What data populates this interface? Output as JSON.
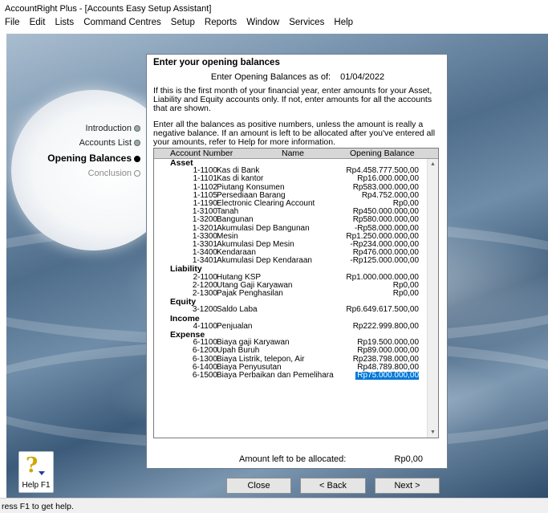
{
  "window": {
    "title": "AccountRight Plus - [Accounts Easy Setup Assistant]"
  },
  "menu": [
    "File",
    "Edit",
    "Lists",
    "Command Centres",
    "Setup",
    "Reports",
    "Window",
    "Services",
    "Help"
  ],
  "nav": {
    "steps": [
      {
        "label": "Introduction",
        "state": "done"
      },
      {
        "label": "Accounts List",
        "state": "done"
      },
      {
        "label": "Opening Balances",
        "state": "active"
      },
      {
        "label": "Conclusion",
        "state": "pending"
      }
    ]
  },
  "dialog": {
    "heading": "Enter your opening balances",
    "date_label": "Enter Opening Balances as of:",
    "date_value": "01/04/2022",
    "para1": "If this is the first month of your financial year, enter amounts for your Asset, Liability and Equity accounts only.  If not, enter amounts for all the accounts that are shown.",
    "para2": "Enter all the balances as positive numbers, unless the amount is really a negative balance.  If an amount is left to be allocated after you've entered all your amounts, refer to Help for more information.",
    "columns": {
      "number": "Account Number",
      "name": "Name",
      "balance": "Opening Balance"
    },
    "groups": [
      {
        "label": "Asset",
        "rows": [
          {
            "number": "1-1100",
            "name": "Kas di Bank",
            "balance": "Rp4.458.777.500,00"
          },
          {
            "number": "1-1101",
            "name": "Kas di kantor",
            "balance": "Rp16.000.000,00"
          },
          {
            "number": "1-1102",
            "name": "Piutang Konsumen",
            "balance": "Rp583.000.000,00"
          },
          {
            "number": "1-1105",
            "name": "Persediaan Barang",
            "balance": "Rp4.752.000,00"
          },
          {
            "number": "1-1190",
            "name": "Electronic Clearing Account",
            "balance": "Rp0,00"
          },
          {
            "number": "1-3100",
            "name": "Tanah",
            "balance": "Rp450.000.000,00"
          },
          {
            "number": "1-3200",
            "name": "Bangunan",
            "balance": "Rp580.000.000,00"
          },
          {
            "number": "1-3201",
            "name": "Akumulasi Dep Bangunan",
            "balance": "-Rp58.000.000,00"
          },
          {
            "number": "1-3300",
            "name": "Mesin",
            "balance": "Rp1.250.000.000,00"
          },
          {
            "number": "1-3301",
            "name": "Akumulasi Dep Mesin",
            "balance": "-Rp234.000.000,00"
          },
          {
            "number": "1-3400",
            "name": "Kendaraan",
            "balance": "Rp476.000.000,00"
          },
          {
            "number": "1-3401",
            "name": "Akumulasi Dep Kendaraan",
            "balance": "-Rp125.000.000,00"
          }
        ]
      },
      {
        "label": "Liability",
        "rows": [
          {
            "number": "2-1100",
            "name": "Hutang KSP",
            "balance": "Rp1.000.000.000,00"
          },
          {
            "number": "2-1200",
            "name": "Utang Gaji Karyawan",
            "balance": "Rp0,00"
          },
          {
            "number": "2-1300",
            "name": "Pajak Penghasilan",
            "balance": "Rp0,00"
          }
        ]
      },
      {
        "label": "Equity",
        "rows": [
          {
            "number": "3-1200",
            "name": "Saldo Laba",
            "balance": "Rp6.649.617.500,00"
          }
        ]
      },
      {
        "label": "Income",
        "rows": [
          {
            "number": "4-1100",
            "name": "Penjualan",
            "balance": "Rp222.999.800,00"
          }
        ]
      },
      {
        "label": "Expense",
        "rows": [
          {
            "number": "6-1100",
            "name": "Biaya gaji Karyawan",
            "balance": "Rp19.500.000,00"
          },
          {
            "number": "6-1200",
            "name": "Upah Buruh",
            "balance": "Rp89.000.000,00"
          },
          {
            "number": "6-1300",
            "name": "Biaya Listrik, telepon, Air",
            "balance": "Rp238.798.000,00"
          },
          {
            "number": "6-1400",
            "name": "Biaya Penyusutan",
            "balance": "Rp48.789.800,00"
          },
          {
            "number": "6-1500",
            "name": "Biaya Perbaikan dan Pemelihara",
            "balance": "Rp75.000.000,00",
            "selected": true
          }
        ]
      }
    ],
    "alloc_label": "Amount left to be allocated:",
    "alloc_value": "Rp0,00"
  },
  "buttons": {
    "close": "Close",
    "back": "< Back",
    "next": "Next >"
  },
  "help": {
    "label": "Help F1",
    "icon": "help-question-icon"
  },
  "status": {
    "text": "ress F1 to get help."
  },
  "colors": {
    "selection": "#0078d7",
    "nav_active_dot": "#000000"
  }
}
